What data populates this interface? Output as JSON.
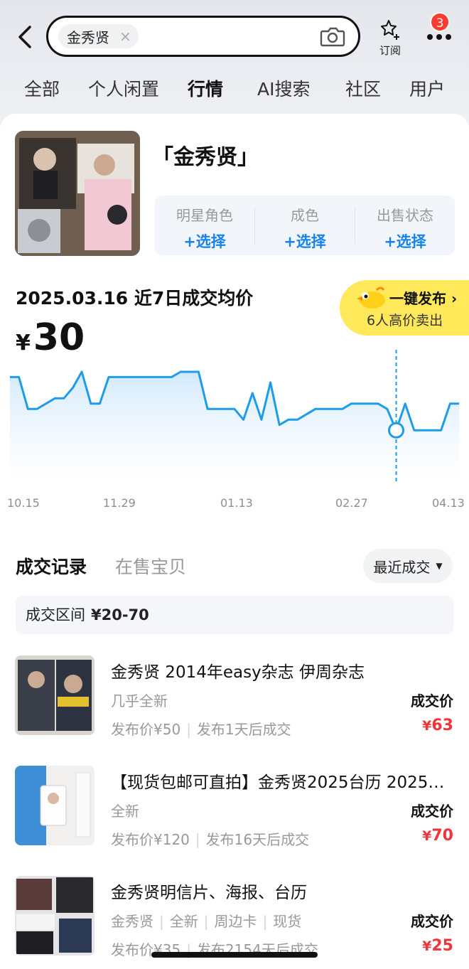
{
  "header": {
    "search_chip": "金秀贤",
    "chip_close": "×",
    "subscribe_label": "订阅",
    "badge_count": "3"
  },
  "tabs": [
    "全部",
    "个人闲置",
    "行情",
    "AI搜索",
    "社区",
    "用户"
  ],
  "active_tab": "行情",
  "product": {
    "title": "「金秀贤」",
    "filters": [
      {
        "name": "明星角色",
        "action": "+选择"
      },
      {
        "name": "成色",
        "action": "+选择"
      },
      {
        "name": "出售状态",
        "action": "+选择"
      }
    ]
  },
  "price": {
    "date_text": "2025.03.16 近7日成交均价",
    "currency": "¥",
    "value": "30"
  },
  "publish": {
    "title": "一键发布",
    "arrow": "›",
    "subtitle": "6人高价卖出"
  },
  "chart_data": {
    "type": "line",
    "x_ticks": [
      "10.15",
      "11.29",
      "01.13",
      "02.27",
      "04.13"
    ],
    "series": [
      {
        "values": [
          30,
          30,
          24,
          24,
          25,
          26,
          26,
          28,
          31,
          25,
          25,
          30,
          30,
          30,
          30,
          30,
          30,
          30,
          30,
          31,
          31,
          31,
          24,
          24,
          24,
          24,
          22,
          27,
          22,
          29,
          21,
          22,
          22,
          23,
          24,
          24,
          24,
          24,
          25,
          25,
          25,
          25,
          24,
          20,
          25,
          20,
          20,
          20,
          20,
          25,
          25
        ]
      }
    ],
    "highlight_index": 43,
    "color": "#1e9ce8",
    "fill_color": "#d6ecfb",
    "grid": false
  },
  "records": {
    "tabs": [
      "成交记录",
      "在售宝贝"
    ],
    "sort_label": "最近成交",
    "range_label": "成交区间",
    "range_value": "¥20-70",
    "deal_label": "成交价",
    "items": [
      {
        "title": "金秀贤 2014年easy杂志 伊周杂志",
        "condition": "几乎全新",
        "meta": [
          "发布价¥50",
          "发布1天后成交"
        ],
        "currency": "¥",
        "price": "63"
      },
      {
        "title": "【现货包邮可直拍】金秀贤2025台历 2025…",
        "condition": "全新",
        "meta": [
          "发布价¥120",
          "发布16天后成交"
        ],
        "currency": "¥",
        "price": "70"
      },
      {
        "title": "金秀贤明信片、海报、台历",
        "tags": [
          "金秀贤",
          "全新",
          "周边卡",
          "现货"
        ],
        "meta": [
          "发布价¥35",
          "发布2154天后成交"
        ],
        "currency": "¥",
        "price": "25"
      }
    ]
  }
}
